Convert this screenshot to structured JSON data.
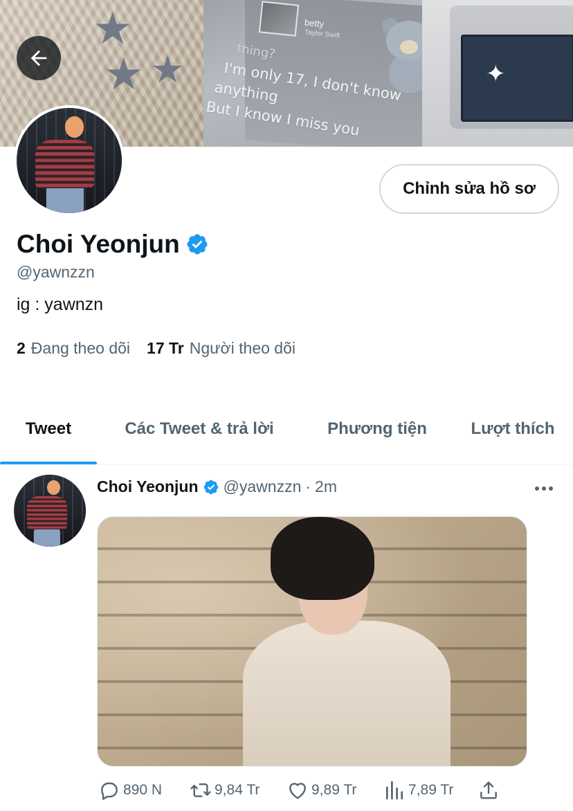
{
  "banner": {
    "song_title": "betty",
    "song_artist": "Taylor Swift",
    "lyric_line_0": "thing?",
    "lyric_line_1": "I'm only 17, I don't know",
    "lyric_line_2": "anything",
    "lyric_line_3": "But I know I miss you"
  },
  "profile": {
    "edit_label": "Chỉnh sửa hồ sơ",
    "display_name": "Choi Yeonjun",
    "handle": "@yawnzzn",
    "bio": "ig : yawnzn",
    "following_count": "2",
    "following_label": "Đang theo dõi",
    "followers_count": "17 Tr",
    "followers_label": "Người theo dõi"
  },
  "tabs": [
    {
      "label": "Tweet",
      "active": true
    },
    {
      "label": "Các Tweet & trả lời",
      "active": false
    },
    {
      "label": "Phương tiện",
      "active": false
    },
    {
      "label": "Lượt thích",
      "active": false
    }
  ],
  "tweet": {
    "author_name": "Choi Yeonjun",
    "author_handle": "@yawnzzn",
    "separator": "·",
    "time": "2m",
    "replies": "890 N",
    "retweets": "9,84 Tr",
    "likes": "9,89 Tr",
    "views": "7,89 Tr"
  },
  "colors": {
    "accent": "#1d9bf0",
    "text_primary": "#0f1419",
    "text_secondary": "#536471"
  },
  "icons": {
    "back": "arrow-left-icon",
    "verified": "verified-badge-icon",
    "more": "more-horizontal-icon",
    "reply": "reply-icon",
    "retweet": "retweet-icon",
    "like": "heart-icon",
    "views": "views-chart-icon",
    "share": "share-icon"
  }
}
